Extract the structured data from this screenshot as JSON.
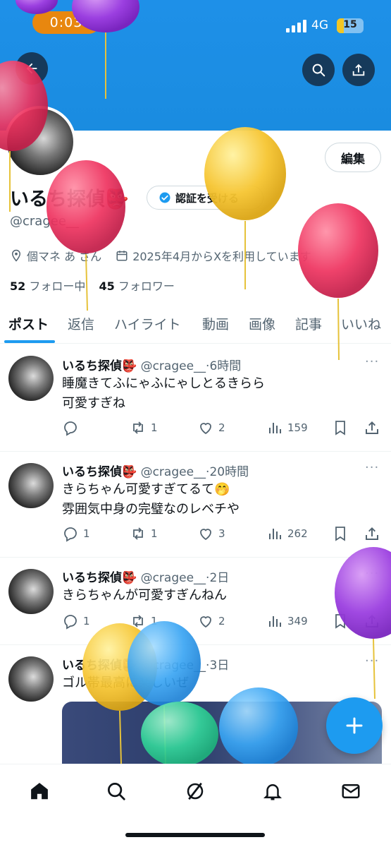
{
  "status": {
    "recording_time": "0:03",
    "network": "4G",
    "battery": "15"
  },
  "profile": {
    "name": "いるち探偵👺",
    "verify_label": "認証を受ける",
    "handle": "@cragee__",
    "location": "個マネ あ  さん",
    "joined": "2025年4月からXを利用しています",
    "following_count": "52",
    "following_label": "フォロー中",
    "followers_count": "45",
    "followers_label": "フォロワー",
    "edit_label": "編集"
  },
  "tabs": [
    {
      "label": "ポスト",
      "active": true
    },
    {
      "label": "返信"
    },
    {
      "label": "ハイライト"
    },
    {
      "label": "動画"
    },
    {
      "label": "画像"
    },
    {
      "label": "記事"
    },
    {
      "label": "いいね"
    }
  ],
  "posts": [
    {
      "name": "いるち探偵👺",
      "handle": "@cragee__",
      "time": "6時間",
      "lines": [
        "睡魔きてふにゃふにゃしとるきらら",
        "可愛すぎね"
      ],
      "replies": "",
      "reposts": "1",
      "likes": "2",
      "views": "159"
    },
    {
      "name": "いるち探偵👺",
      "handle": "@cragee__",
      "time": "20時間",
      "lines": [
        "きらちゃん可愛すぎてるて🤭",
        "雰囲気中身の完璧なのレベチや"
      ],
      "replies": "1",
      "reposts": "1",
      "likes": "3",
      "views": "262"
    },
    {
      "name": "いるち探偵👺",
      "handle": "@cragee__",
      "time": "2日",
      "lines": [
        "きらちゃんが可愛すぎんねん"
      ],
      "replies": "1",
      "reposts": "1",
      "likes": "2",
      "views": "349"
    },
    {
      "name": "いるち探偵👺",
      "handle": "@cragee__",
      "time": "3日",
      "lines": [
        "ゴル帯最高に楽しいぜ"
      ]
    }
  ],
  "nav": [
    "home-icon",
    "search-icon",
    "grok-icon",
    "bell-icon",
    "mail-icon"
  ],
  "colors": {
    "accent": "#1d9bf0",
    "banner": "#1a8ce0"
  }
}
